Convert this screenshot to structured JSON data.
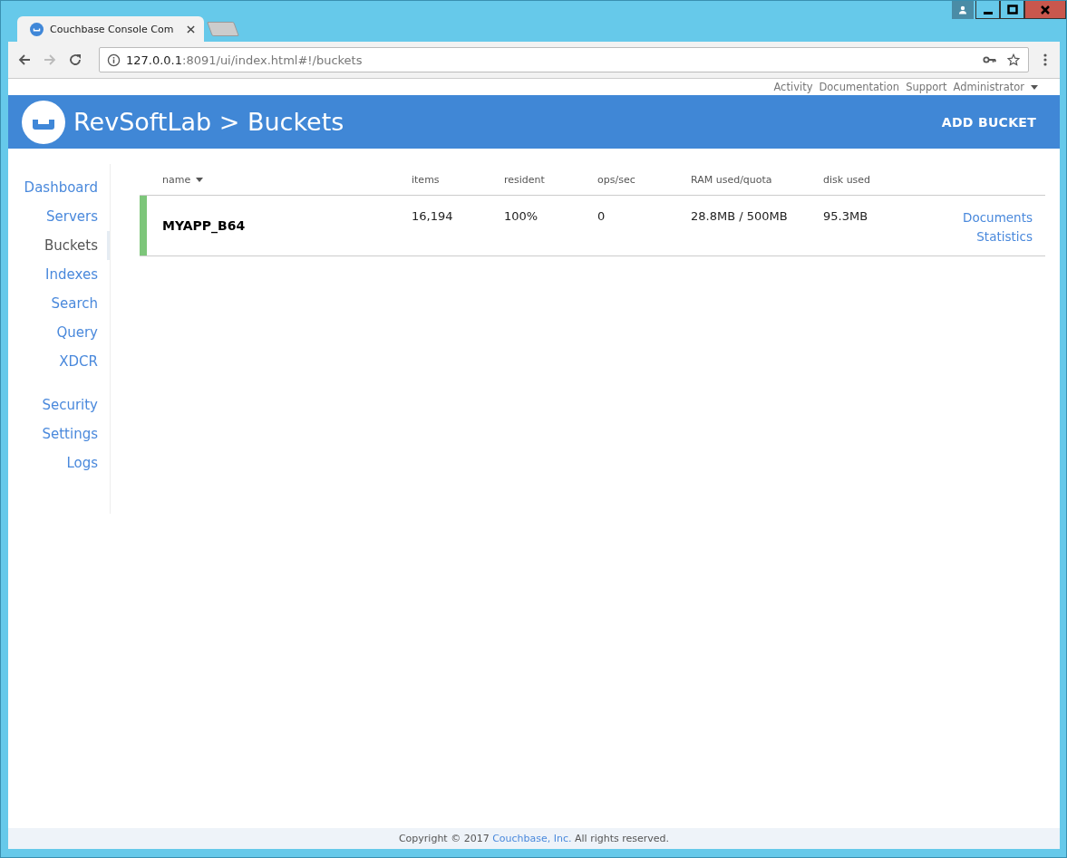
{
  "browser": {
    "tab_title": "Couchbase Console Com",
    "url_host": "127.0.0.1",
    "url_path": ":8091/ui/index.html#!/buckets"
  },
  "top_links": [
    "Activity",
    "Documentation",
    "Support",
    "Administrator"
  ],
  "header": {
    "title": "RevSoftLab > Buckets",
    "action": "ADD BUCKET"
  },
  "sidebar": {
    "groups": [
      [
        {
          "label": "Dashboard",
          "selected": false
        },
        {
          "label": "Servers",
          "selected": false
        },
        {
          "label": "Buckets",
          "selected": true
        },
        {
          "label": "Indexes",
          "selected": false
        },
        {
          "label": "Search",
          "selected": false
        },
        {
          "label": "Query",
          "selected": false
        },
        {
          "label": "XDCR",
          "selected": false
        }
      ],
      [
        {
          "label": "Security",
          "selected": false
        },
        {
          "label": "Settings",
          "selected": false
        },
        {
          "label": "Logs",
          "selected": false
        }
      ]
    ]
  },
  "table": {
    "columns": [
      {
        "label": "name",
        "sorted": true
      },
      {
        "label": "items",
        "sorted": false
      },
      {
        "label": "resident",
        "sorted": false
      },
      {
        "label": "ops/sec",
        "sorted": false
      },
      {
        "label": "RAM used/quota",
        "sorted": false
      },
      {
        "label": "disk used",
        "sorted": false
      }
    ],
    "rows": [
      {
        "color": "#7dc67a",
        "cells": [
          "MYAPP_B64",
          "16,194",
          "100%",
          "0",
          "28.8MB / 500MB",
          "95.3MB"
        ],
        "links": [
          "Documents",
          "Statistics"
        ]
      }
    ]
  },
  "footer": {
    "before": "Copyright © 2017 ",
    "link": "Couchbase, Inc.",
    "after": " All rights reserved."
  }
}
